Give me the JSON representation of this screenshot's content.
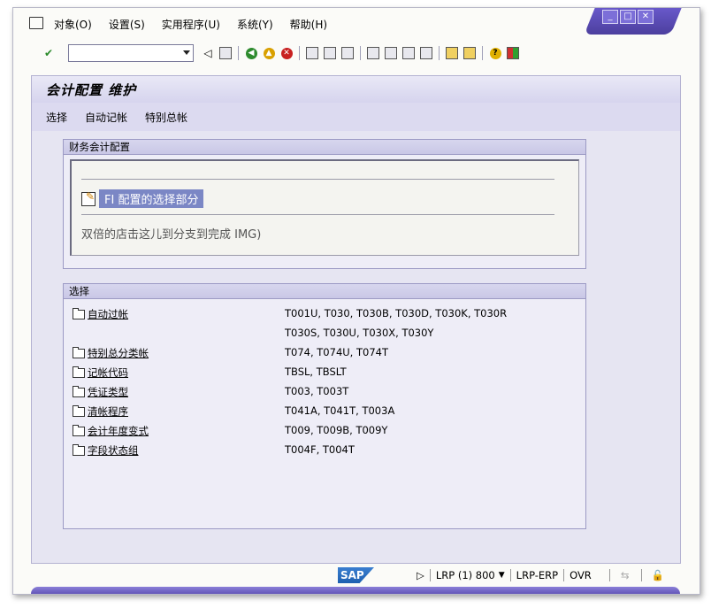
{
  "menu": {
    "items": [
      "对象(O)",
      "设置(S)",
      "实用程序(U)",
      "系统(Y)",
      "帮助(H)"
    ]
  },
  "window_controls": {
    "minimize": "_",
    "maximize": "□",
    "close": "✕"
  },
  "toolbar": {
    "command_field_value": ""
  },
  "title": {
    "text": "会计配置 维护"
  },
  "appbar": {
    "items": [
      "选择",
      "自动记帐",
      "特别总帐"
    ]
  },
  "fi_group": {
    "title": "财务会计配置",
    "selected_label": "FI 配置的选择部分",
    "hint": "双倍的店击这儿到分支到完成 IMG)"
  },
  "selection_group": {
    "title": "选择",
    "rows": [
      {
        "label": "自动过帐",
        "tables": [
          "T001U, T030,  T030B, T030D, T030K, T030R",
          "T030S, T030U, T030X, T030Y"
        ]
      },
      {
        "label": "特别总分类帐",
        "tables": [
          "T074,  T074U, T074T"
        ]
      },
      {
        "label": "记帐代码",
        "tables": [
          "TBSL,  TBSLT"
        ]
      },
      {
        "label": "凭证类型",
        "tables": [
          "T003,  T003T"
        ]
      },
      {
        "label": "清帐程序",
        "tables": [
          "T041A, T041T, T003A"
        ]
      },
      {
        "label": "会计年度变式",
        "tables": [
          "T009,  T009B, T009Y"
        ]
      },
      {
        "label": "字段状态组",
        "tables": [
          "T004F, T004T"
        ]
      }
    ]
  },
  "status": {
    "logo": "SAP",
    "system": "LRP (1) 800",
    "server": "LRP-ERP",
    "mode": "OVR"
  }
}
